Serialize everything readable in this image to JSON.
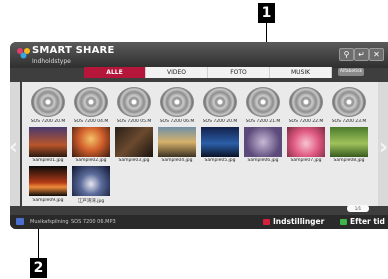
{
  "callouts": {
    "one": "1",
    "two": "2"
  },
  "header": {
    "title": "SMART SHARE",
    "content_type": "Indholdstype",
    "search_icon": "search-icon",
    "back_icon": "back-icon",
    "close_icon": "close-icon"
  },
  "tabs": [
    {
      "label": "ALLE",
      "active": true
    },
    {
      "label": "VIDEO",
      "active": false
    },
    {
      "label": "FOTO",
      "active": false
    },
    {
      "label": "MUSIK",
      "active": false
    }
  ],
  "sort": {
    "label": "Alfabetisk"
  },
  "music_files": [
    "SOS 7200 20.M",
    "SOS 7200 04.M",
    "SOS 7200 05.M",
    "SOS 7200 06.M",
    "SOS 7200 20.M",
    "SOS 7200 21.M",
    "SOS 7200 22.M",
    "SOS 7200 23.M"
  ],
  "photos_row2": [
    "Sample01.jpg",
    "Sample02.jpg",
    "Sample03.jpg",
    "Sample04.jpg",
    "Sample05.jpg",
    "Sample06.jpg",
    "Sample07.jpg",
    "Sample08.jpg"
  ],
  "photos_row3": [
    "Sample09.jpg",
    "江戸湾湾.jpg"
  ],
  "pager": "1/1",
  "footer": {
    "now_playing_label": "Musikafspilning",
    "now_playing_track": "SOS 7200 06.MP3",
    "settings_label": "Indstillinger",
    "sort_by_label": "Efter tid",
    "red_color": "#d7203a",
    "green_color": "#3db548"
  },
  "colors": {
    "accent": "#b5163a"
  }
}
